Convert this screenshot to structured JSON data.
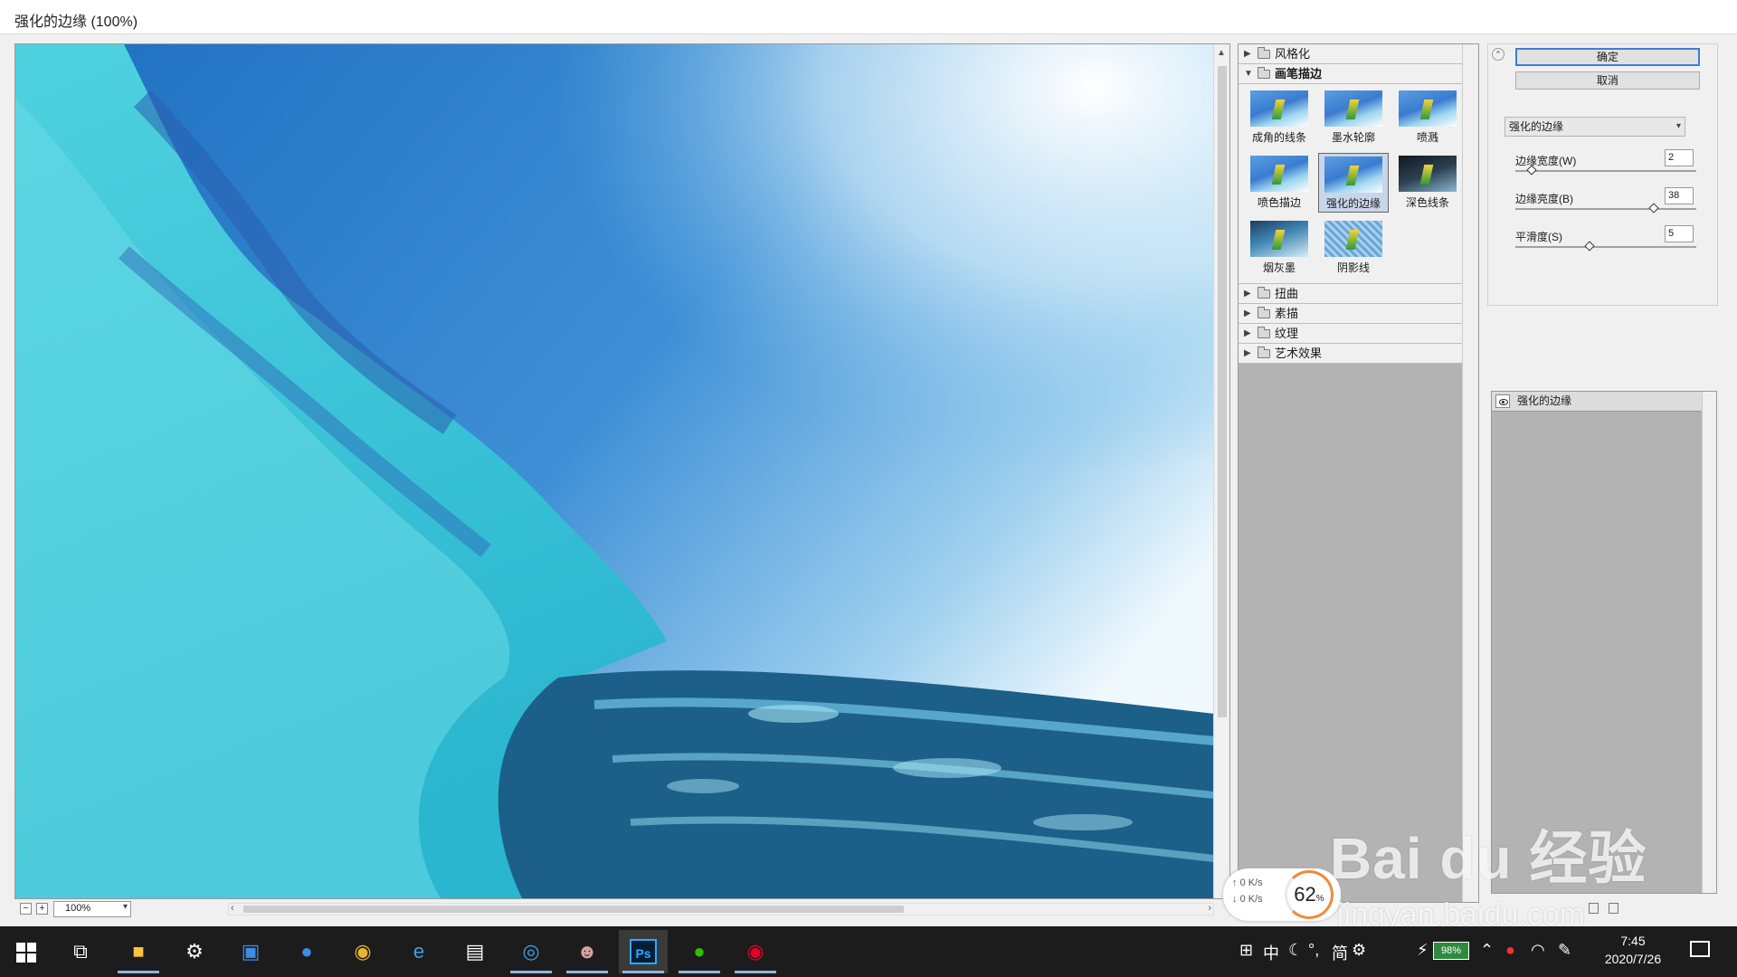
{
  "window": {
    "title": "强化的边缘 (100%)"
  },
  "preview": {
    "zoom_value": "100%",
    "zoom_minus": "−",
    "zoom_plus": "+"
  },
  "filter_gallery": {
    "folders_before": [
      {
        "label": "风格化",
        "expanded": false
      }
    ],
    "open_folder": {
      "label": "画笔描边",
      "expanded": true
    },
    "thumbnails": [
      {
        "label": "成角的线条",
        "selected": false
      },
      {
        "label": "墨水轮廓",
        "selected": false
      },
      {
        "label": "喷溅",
        "selected": false
      },
      {
        "label": "喷色描边",
        "selected": false
      },
      {
        "label": "强化的边缘",
        "selected": true
      },
      {
        "label": "深色线条",
        "selected": false
      },
      {
        "label": "烟灰墨",
        "selected": false
      },
      {
        "label": "阴影线",
        "selected": false
      }
    ],
    "folders_after": [
      {
        "label": "扭曲"
      },
      {
        "label": "素描"
      },
      {
        "label": "纹理"
      },
      {
        "label": "艺术效果"
      }
    ]
  },
  "controls": {
    "ok_label": "确定",
    "cancel_label": "取消",
    "selected_filter": "强化的边缘",
    "params": [
      {
        "label": "边缘宽度(W)",
        "value": "2",
        "fraction": 0.07
      },
      {
        "label": "边缘亮度(B)",
        "value": "38",
        "fraction": 0.76
      },
      {
        "label": "平滑度(S)",
        "value": "5",
        "fraction": 0.4
      }
    ]
  },
  "effect_layers": [
    {
      "label": "强化的边缘"
    }
  ],
  "net_widget": {
    "up": "0 K/s",
    "down": "0 K/s",
    "percent": "62",
    "percent_unit": "%"
  },
  "watermark": {
    "text": "Bai du 经验",
    "url": "jingyan.baidu.com"
  },
  "taskbar": {
    "tray_ime": "中",
    "tray_simplified": "简",
    "battery": "98%",
    "time": "7:45",
    "date": "2020/7/26"
  },
  "colors": {
    "accent": "#3c7fd4",
    "panel_gray": "#b3b3b3",
    "taskbar": "#1c1c1c"
  }
}
